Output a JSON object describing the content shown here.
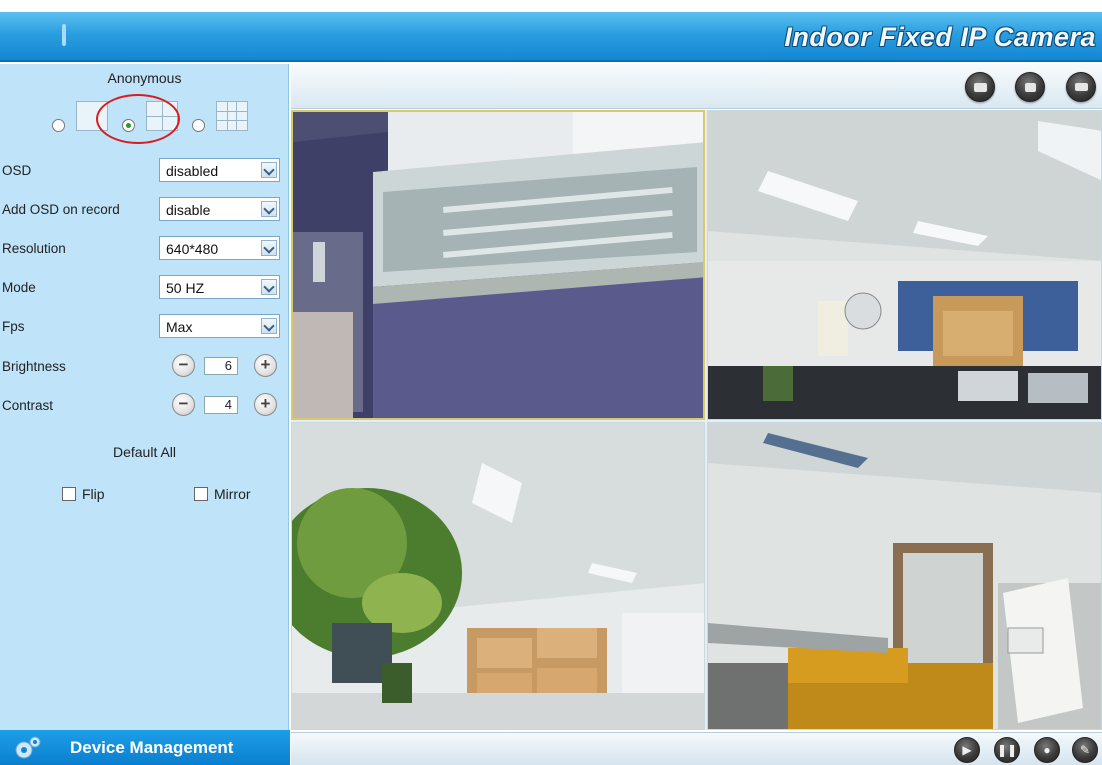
{
  "app": {
    "title": "Indoor Fixed IP Camera"
  },
  "user": {
    "name": "Anonymous"
  },
  "layout": {
    "options": [
      {
        "name": "1-screen",
        "checked": false
      },
      {
        "name": "4-screen",
        "checked": true
      },
      {
        "name": "9-screen",
        "checked": false
      }
    ],
    "highlight_color": "#d81e1e"
  },
  "settings": {
    "osd": {
      "label": "OSD",
      "value": "disabled"
    },
    "osd_record": {
      "label": "Add OSD on record",
      "value": "disable"
    },
    "resolution": {
      "label": "Resolution",
      "value": "640*480"
    },
    "mode": {
      "label": "Mode",
      "value": "50 HZ"
    },
    "fps": {
      "label": "Fps",
      "value": "Max"
    },
    "brightness": {
      "label": "Brightness",
      "value": "6",
      "minus": "−",
      "plus": "+"
    },
    "contrast": {
      "label": "Contrast",
      "value": "4",
      "minus": "−",
      "plus": "+"
    },
    "default_all": "Default All",
    "flip": {
      "label": "Flip",
      "checked": false
    },
    "mirror": {
      "label": "Mirror",
      "checked": false
    }
  },
  "toolbar": {
    "buttons": [
      "snapshot-icon",
      "record-icon",
      "fullscreen-icon"
    ]
  },
  "nav": {
    "device_management": "Device Management"
  },
  "controls": {
    "buttons": [
      "play-icon",
      "stop-icon",
      "talk-icon",
      "audio-icon"
    ]
  },
  "colors": {
    "banner": "#1487d2",
    "panel": "#bfe3f8",
    "nav": "#0b7fcf"
  }
}
